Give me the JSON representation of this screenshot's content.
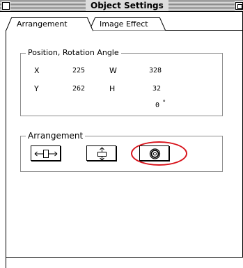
{
  "window": {
    "title": "Object Settings",
    "close_icon": "close-box-icon",
    "zoom_icon": "zoom-box-icon"
  },
  "tabs": [
    {
      "label": "Arrangement",
      "active": true
    },
    {
      "label": "Image Effect",
      "active": false
    }
  ],
  "position_group": {
    "title": "Position, Rotation Angle",
    "x_label": "X",
    "x_value": "225",
    "w_label": "W",
    "w_value": "328",
    "y_label": "Y",
    "y_value": "262",
    "h_label": "H",
    "h_value": "32",
    "angle_value": "0",
    "angle_unit": "°"
  },
  "arrangement_group": {
    "title": "Arrangement",
    "buttons": [
      {
        "name": "align-horizontal-center",
        "icon": "horizontal-center-icon"
      },
      {
        "name": "align-vertical-center",
        "icon": "vertical-center-icon"
      },
      {
        "name": "align-center",
        "icon": "center-target-icon"
      }
    ],
    "highlight_color": "#d8141c"
  }
}
